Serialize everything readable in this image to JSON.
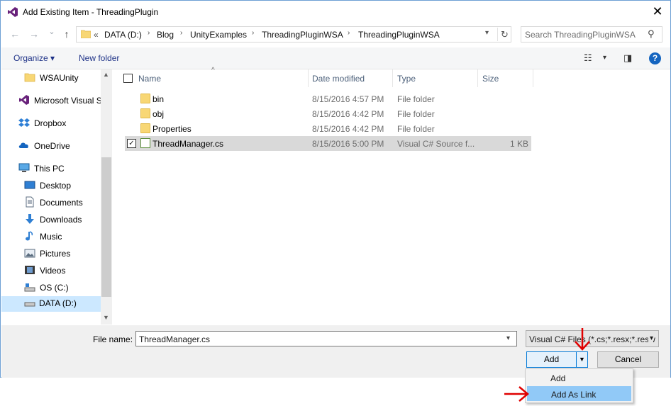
{
  "window": {
    "title": "Add Existing Item - ThreadingPlugin",
    "close_glyph": "✕"
  },
  "nav": {
    "back": "←",
    "forward": "→",
    "recent": "⌄",
    "up": "↑",
    "overflow": "«",
    "breadcrumbs": [
      "DATA (D:)",
      "Blog",
      "UnityExamples",
      "ThreadingPluginWSA",
      "ThreadingPluginWSA"
    ],
    "search_placeholder": "Search ThreadingPluginWSA"
  },
  "toolbar": {
    "organize": "Organize ▾",
    "new_folder": "New folder",
    "help": "?"
  },
  "sidebar": {
    "items": [
      {
        "label": "WSAUnity",
        "icon": "folder-icon"
      },
      {
        "label": "Microsoft Visual S",
        "icon": "visual-studio-icon"
      },
      {
        "label": "Dropbox",
        "icon": "dropbox-icon"
      },
      {
        "label": "OneDrive",
        "icon": "onedrive-icon"
      },
      {
        "label": "This PC",
        "icon": "computer-icon"
      },
      {
        "label": "Desktop",
        "icon": "desktop-icon"
      },
      {
        "label": "Documents",
        "icon": "documents-icon"
      },
      {
        "label": "Downloads",
        "icon": "downloads-icon"
      },
      {
        "label": "Music",
        "icon": "music-icon"
      },
      {
        "label": "Pictures",
        "icon": "pictures-icon"
      },
      {
        "label": "Videos",
        "icon": "videos-icon"
      },
      {
        "label": "OS (C:)",
        "icon": "drive-icon"
      },
      {
        "label": "DATA (D:)",
        "icon": "drive-icon"
      }
    ]
  },
  "filelist": {
    "columns": [
      "Name",
      "Date modified",
      "Type",
      "Size"
    ],
    "rows": [
      {
        "name": "bin",
        "date": "8/15/2016 4:57 PM",
        "type": "File folder",
        "size": ""
      },
      {
        "name": "obj",
        "date": "8/15/2016 4:42 PM",
        "type": "File folder",
        "size": ""
      },
      {
        "name": "Properties",
        "date": "8/15/2016 4:42 PM",
        "type": "File folder",
        "size": ""
      },
      {
        "name": "ThreadManager.cs",
        "date": "8/15/2016 5:00 PM",
        "type": "Visual C# Source f...",
        "size": "1 KB"
      }
    ]
  },
  "bottom": {
    "file_name_label": "File name:",
    "file_name_value": "ThreadManager.cs",
    "filter_value": "Visual C# Files (*.cs;*.resx;*.resw",
    "add_label": "Add",
    "cancel_label": "Cancel"
  },
  "menu": {
    "items": [
      "Add",
      "Add As Link"
    ]
  },
  "colors": {
    "annotation_red": "#e00000",
    "accent_blue": "#0078d7"
  }
}
